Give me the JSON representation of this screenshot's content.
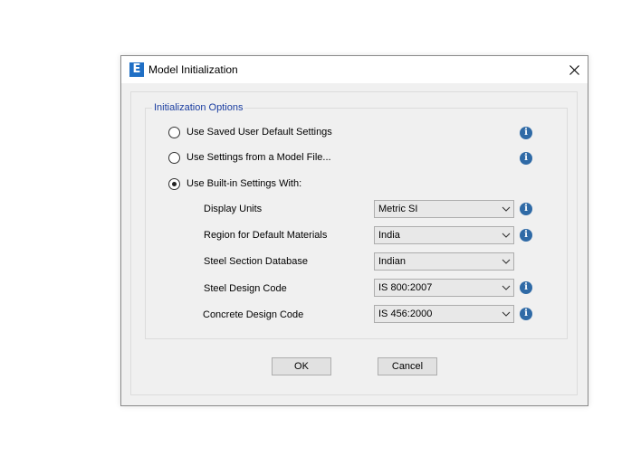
{
  "dialog": {
    "title": "Model Initialization",
    "app_icon_letter": "E",
    "close_glyph": "close-icon"
  },
  "group": {
    "legend": "Initialization Options"
  },
  "options": [
    {
      "label": "Use Saved User Default Settings",
      "checked": false
    },
    {
      "label": "Use Settings from a Model File...",
      "checked": false
    },
    {
      "label": "Use Built-in Settings With:",
      "checked": true
    }
  ],
  "settings": [
    {
      "label": "Display Units",
      "value": "Metric SI"
    },
    {
      "label": "Region for Default Materials",
      "value": "India"
    },
    {
      "label": "Steel Section Database",
      "value": "Indian"
    },
    {
      "label": "Steel Design Code",
      "value": "IS 800:2007"
    },
    {
      "label": "Concrete Design Code",
      "value": "IS 456:2000"
    }
  ],
  "info_icon_glyph": "i",
  "buttons": {
    "ok": "OK",
    "cancel": "Cancel"
  },
  "colors": {
    "legend": "#1a3da0",
    "info_icon": "#2f6aa6",
    "app_icon": "#1f6fc5"
  }
}
